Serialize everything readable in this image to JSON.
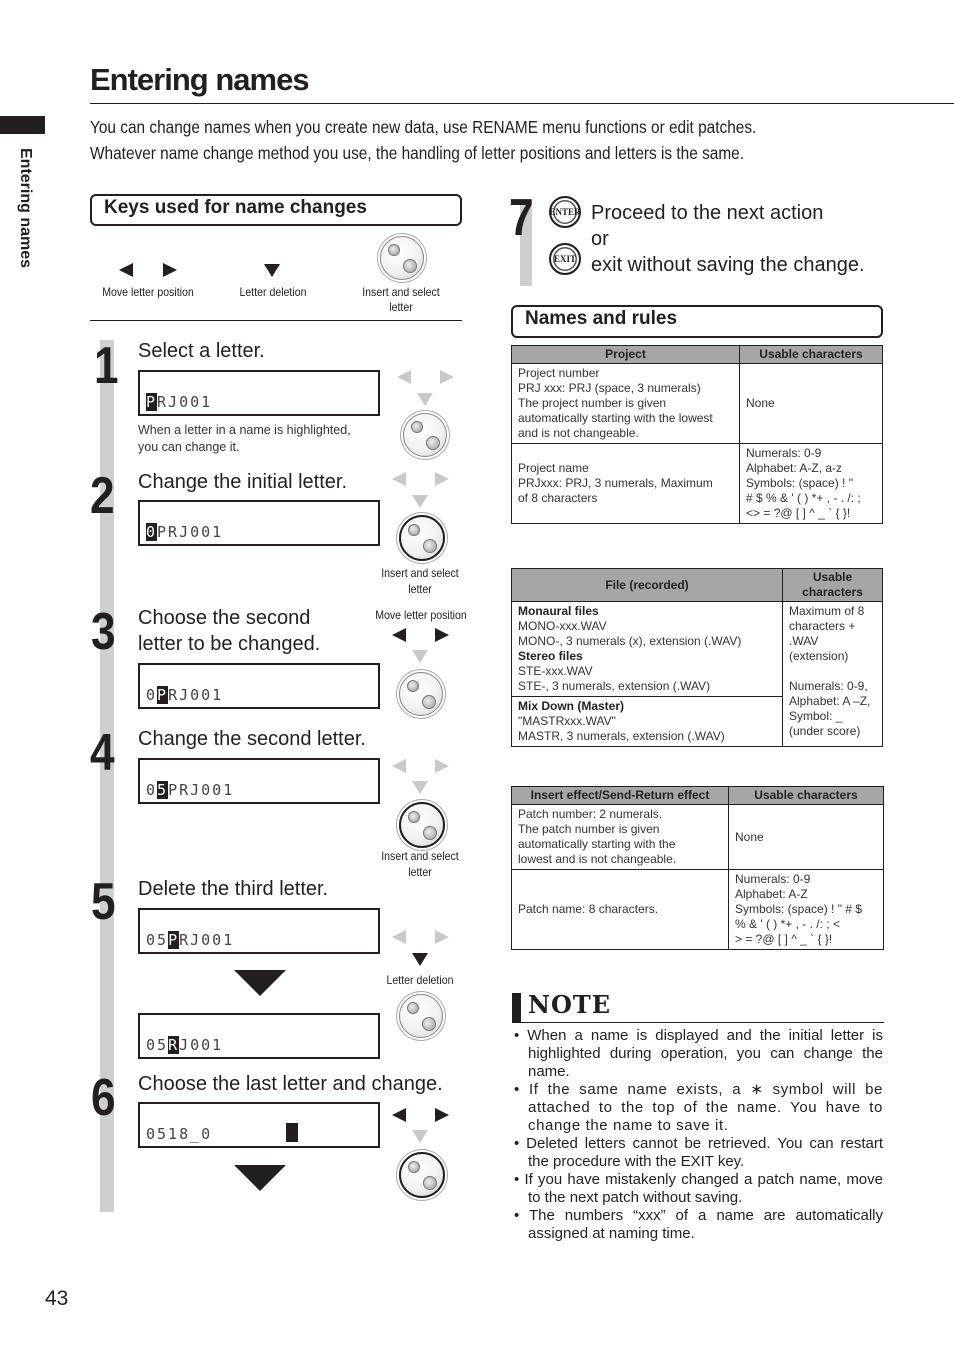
{
  "header": {
    "title": "Entering names",
    "side_tab_label": "Entering names",
    "intro_line1": "You can change names when you create new data, use RENAME menu functions or edit patches.",
    "intro_line2": "Whatever name change method you use, the handling of letter positions and letters is the same."
  },
  "keys_section": {
    "title": "Keys used for name changes",
    "keys": [
      {
        "icon": "left-right-arrows",
        "label": "Move letter position"
      },
      {
        "icon": "down-arrow",
        "label": "Letter deletion"
      },
      {
        "icon": "dial",
        "label_line1": "Insert and select",
        "label_line2": "letter"
      }
    ]
  },
  "steps": [
    {
      "number": "1",
      "title": "Select a letter.",
      "display": {
        "before": "",
        "highlight": "P",
        "after": "RJ001"
      },
      "note_line1": "When a letter in a name is highlighted,",
      "note_line2": "you can change it."
    },
    {
      "number": "2",
      "title": "Change the initial letter.",
      "display": {
        "before": "",
        "highlight": "0",
        "after": "PRJ001"
      },
      "caption_line1": "Insert and select",
      "caption_line2": "letter"
    },
    {
      "number": "3",
      "title_line1": "Choose the second",
      "title_line2": "letter to be changed.",
      "display": {
        "before": "0",
        "highlight": "P",
        "after": "RJ001"
      },
      "caption": "Move letter position"
    },
    {
      "number": "4",
      "title": "Change the second letter.",
      "display": {
        "before": "0",
        "highlight": "5",
        "after": "PRJ001"
      },
      "caption_line1": "Insert and select",
      "caption_line2": "letter"
    },
    {
      "number": "5",
      "title": "Delete the third letter.",
      "display": {
        "before": "05",
        "highlight": "P",
        "after": "RJ001"
      },
      "display_after": {
        "before": "05",
        "highlight": "R",
        "after": "J001"
      },
      "caption": "Letter deletion"
    },
    {
      "number": "6",
      "title": "Choose the last letter and change.",
      "display": {
        "before": "0518_0",
        "highlight": "",
        "after": ""
      }
    },
    {
      "number": "7",
      "enter_label": "ENTER",
      "exit_label": "EXIT",
      "line1": "Proceed to the next action",
      "line2": "or",
      "line3": "exit without saving the change."
    }
  ],
  "names_section": {
    "title": "Names and rules",
    "project_table": {
      "headers": [
        "Project",
        "Usable characters"
      ],
      "rows": [
        {
          "desc": [
            "Project number",
            "PRJ xxx: PRJ (space, 3 numerals)",
            "The project number is given",
            "automatically starting with the lowest",
            "and is not changeable."
          ],
          "usable": [
            "None"
          ]
        },
        {
          "desc": [
            "Project name",
            "PRJxxx: PRJ, 3 numerals, Maximum",
            "of 8 characters"
          ],
          "usable": [
            "Numerals: 0-9",
            "Alphabet: A-Z, a-z",
            "Symbols: (space) ! \"",
            "# $ % & ' ( ) *+ , - . /: ;",
            "<> = ?@ [ ] ^ _ ` { }!"
          ]
        }
      ]
    },
    "file_table": {
      "headers": [
        "File (recorded)",
        "Usable characters"
      ],
      "rows": [
        {
          "heading1": "Monaural files",
          "lines1": [
            "MONO-xxx.WAV",
            "MONO-, 3 numerals (x), extension (.WAV)"
          ],
          "heading2": "Stereo files",
          "lines2": [
            "STE-xxx.WAV",
            "STE-, 3 numerals, extension (.WAV)"
          ]
        },
        {
          "heading1": "Mix Down (Master)",
          "lines1": [
            "\"MASTRxxx.WAV\"",
            "MASTR, 3 numerals, extension (.WAV)"
          ]
        }
      ],
      "usable": [
        "Maximum of 8",
        "characters +",
        ".WAV",
        "(extension)",
        "",
        "Numerals: 0-9,",
        "Alphabet: A –Z,",
        "Symbol: _",
        "(under score)"
      ]
    },
    "effect_table": {
      "headers": [
        "Insert effect/Send-Return effect",
        "Usable characters"
      ],
      "rows": [
        {
          "desc": [
            "Patch number: 2 numerals.",
            "The patch number is given",
            "automatically starting with the",
            "lowest and is not changeable."
          ],
          "usable": [
            "None"
          ]
        },
        {
          "desc": [
            "Patch name: 8 characters."
          ],
          "usable": [
            "Numerals: 0-9",
            "Alphabet: A-Z",
            "Symbols: (space) ! \" # $",
            "% & ' ( ) *+ , - . /: ; <",
            "> = ?@ [ ] ^ _ ` { }!"
          ]
        }
      ]
    }
  },
  "note": {
    "title": "NOTE",
    "items": [
      "• When a name is displayed and the initial letter is highlighted during operation, you can change the name.",
      "• If the same name exists, a ∗ symbol will be attached to the top of the name. You have to change the name to save it.",
      "• Deleted letters cannot be retrieved. You can restart the procedure with the EXIT key.",
      "• If you have mistakenly changed a patch name, move to the next patch without saving.",
      "• The numbers “xxx” of a name are automatically assigned at naming time."
    ]
  },
  "footer": {
    "page_number": "43"
  }
}
